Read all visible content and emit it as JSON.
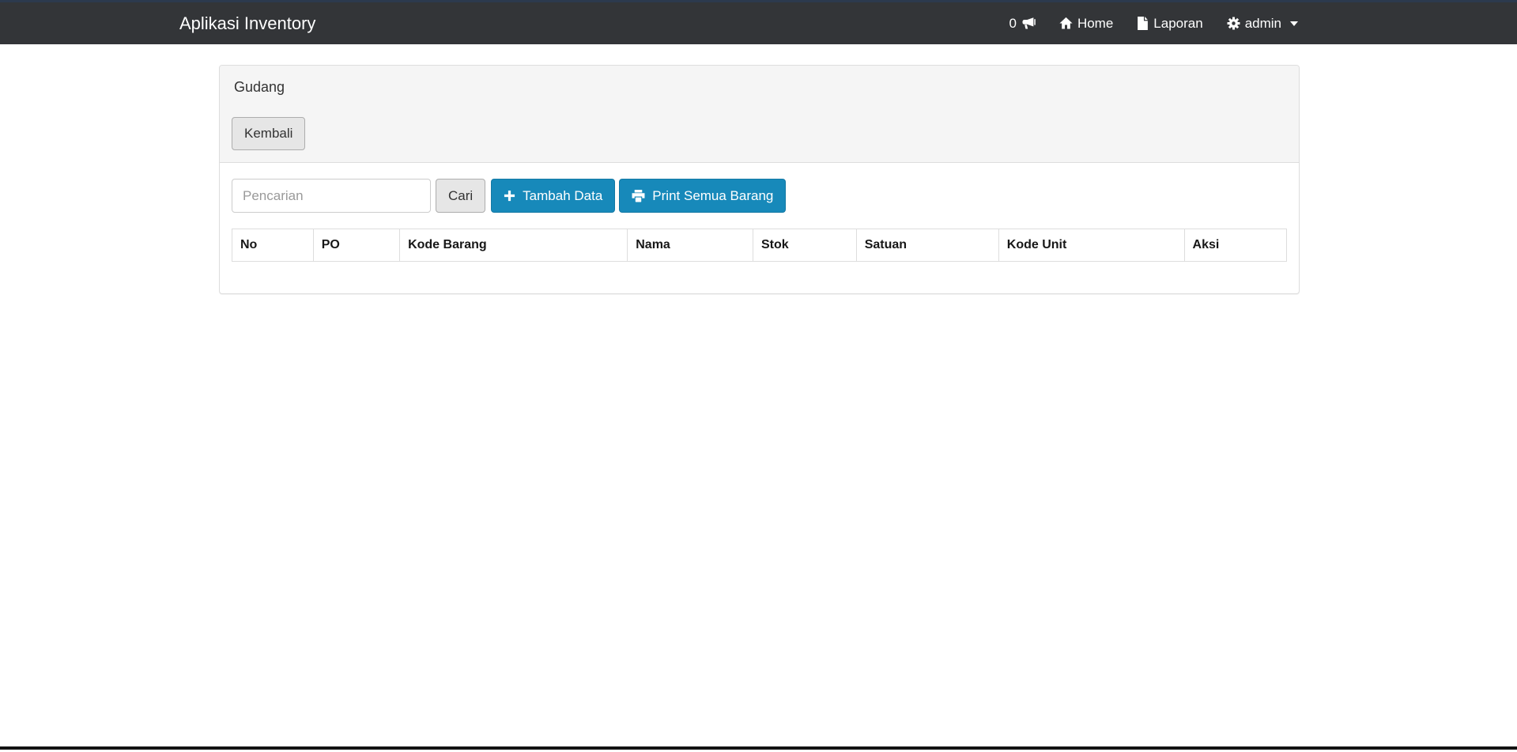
{
  "navbar": {
    "brand": "Aplikasi Inventory",
    "notification_count": "0",
    "items": [
      {
        "label": "Home"
      },
      {
        "label": "Laporan"
      },
      {
        "label": "admin"
      }
    ]
  },
  "panel": {
    "heading_title": "Gudang",
    "back_button": "Kembali",
    "search": {
      "placeholder": "Pencarian",
      "button": "Cari"
    },
    "add_button": "Tambah Data",
    "print_button": "Print Semua Barang",
    "table": {
      "headers": [
        "No",
        "PO",
        "Kode Barang",
        "Nama",
        "Stok",
        "Satuan",
        "Kode Unit",
        "Aksi"
      ],
      "rows": []
    }
  },
  "colors": {
    "accent_blue": "#1789ba",
    "navbar_bg": "#333538",
    "panel_heading_bg": "#f5f5f5",
    "border": "#dddddd"
  }
}
